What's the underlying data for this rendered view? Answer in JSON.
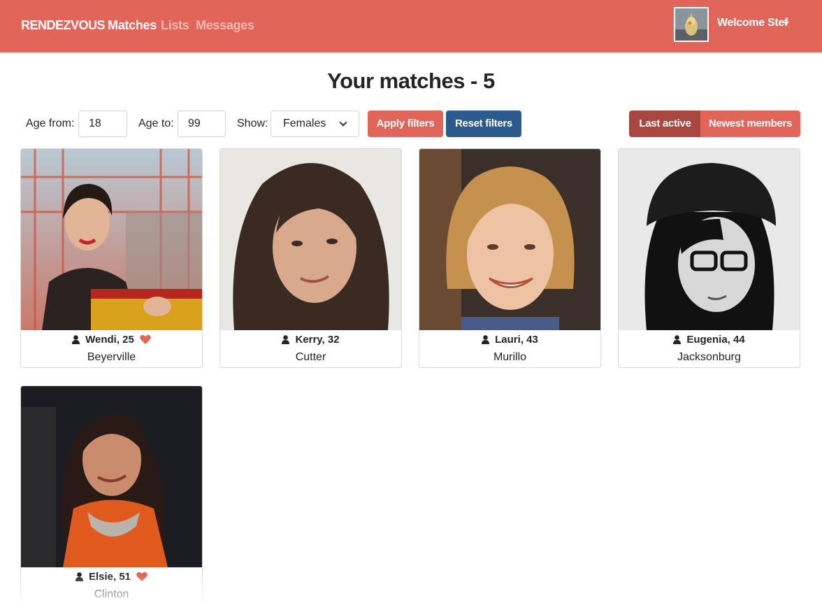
{
  "navbar": {
    "brand": "RENDEZVOUS",
    "links": [
      "Matches",
      "Lists",
      "Messages"
    ],
    "welcome": "Welcome Stef",
    "color": "#e16559"
  },
  "page": {
    "title": "Your matches - 5"
  },
  "filters": {
    "age_from_label": "Age from:",
    "age_from_value": "18",
    "age_to_label": "Age to:",
    "age_to_value": "99",
    "show_label": "Show:",
    "show_value": "Females",
    "apply_label": "Apply filters",
    "reset_label": "Reset filters",
    "sort_options": [
      "Last active",
      "Newest members"
    ],
    "sort_selected": "Last active"
  },
  "members": [
    {
      "name": "Wendi, 25",
      "city": "Beyerville",
      "liked": true
    },
    {
      "name": "Kerry, 32",
      "city": "Cutter",
      "liked": false
    },
    {
      "name": "Lauri, 43",
      "city": "Murillo",
      "liked": false
    },
    {
      "name": "Eugenia, 44",
      "city": "Jacksonburg",
      "liked": false
    },
    {
      "name": "Elsie, 51",
      "city": "Clinton",
      "liked": true
    }
  ],
  "icons": {
    "user": "user-icon",
    "heart": "heart-icon",
    "dropdown": "chevron-down-icon",
    "caret": "caret-down-icon"
  },
  "colors": {
    "primary": "#e16559",
    "secondary": "#2c5a8c",
    "active_segment": "#a8473f"
  }
}
